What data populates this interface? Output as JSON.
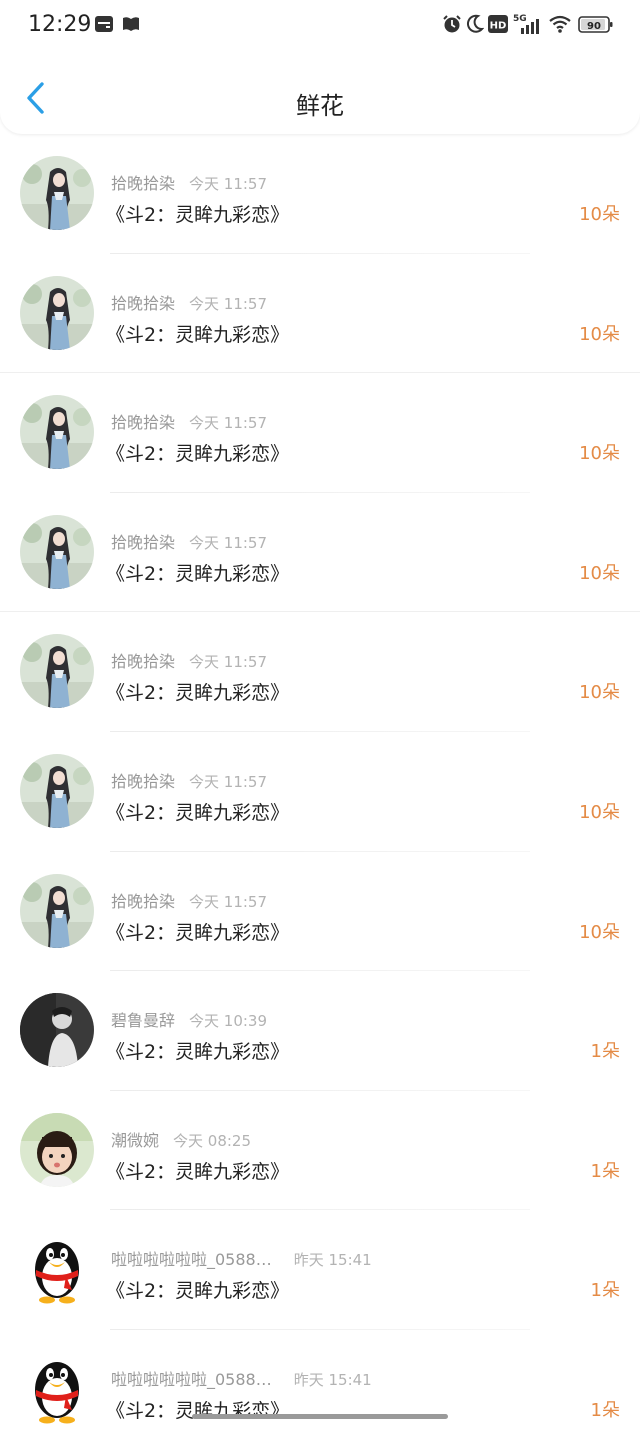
{
  "status_bar": {
    "time": "12:29",
    "network": "5G",
    "battery": "90"
  },
  "nav": {
    "title": "鲜花"
  },
  "rows": [
    {
      "username": "拾晚拾染",
      "time": "今天 11:57",
      "book": "《斗2：灵眸九彩恋》",
      "count": "10朵",
      "avatar": "girl-illustration"
    },
    {
      "username": "拾晚拾染",
      "time": "今天 11:57",
      "book": "《斗2：灵眸九彩恋》",
      "count": "10朵",
      "avatar": "girl-illustration"
    },
    {
      "username": "拾晚拾染",
      "time": "今天 11:57",
      "book": "《斗2：灵眸九彩恋》",
      "count": "10朵",
      "avatar": "girl-illustration"
    },
    {
      "username": "拾晚拾染",
      "time": "今天 11:57",
      "book": "《斗2：灵眸九彩恋》",
      "count": "10朵",
      "avatar": "girl-illustration"
    },
    {
      "username": "拾晚拾染",
      "time": "今天 11:57",
      "book": "《斗2：灵眸九彩恋》",
      "count": "10朵",
      "avatar": "girl-illustration"
    },
    {
      "username": "拾晚拾染",
      "time": "今天 11:57",
      "book": "《斗2：灵眸九彩恋》",
      "count": "10朵",
      "avatar": "girl-illustration"
    },
    {
      "username": "拾晚拾染",
      "time": "今天 11:57",
      "book": "《斗2：灵眸九彩恋》",
      "count": "10朵",
      "avatar": "girl-illustration"
    },
    {
      "username": "碧鲁曼辞",
      "time": "今天 10:39",
      "book": "《斗2：灵眸九彩恋》",
      "count": "1朵",
      "avatar": "dark-portrait"
    },
    {
      "username": "潮微婉",
      "time": "今天 08:25",
      "book": "《斗2：灵眸九彩恋》",
      "count": "1朵",
      "avatar": "child-photo"
    },
    {
      "username": "啦啦啦啦啦啦_0588…",
      "time": "昨天 15:41",
      "book": "《斗2：灵眸九彩恋》",
      "count": "1朵",
      "avatar": "penguin"
    },
    {
      "username": "啦啦啦啦啦啦_0588…",
      "time": "昨天 15:41",
      "book": "《斗2：灵眸九彩恋》",
      "count": "1朵",
      "avatar": "penguin"
    }
  ],
  "colors": {
    "accent_blue": "#2b9fe6",
    "count_orange": "#e48b46",
    "meta_gray": "#999999"
  }
}
